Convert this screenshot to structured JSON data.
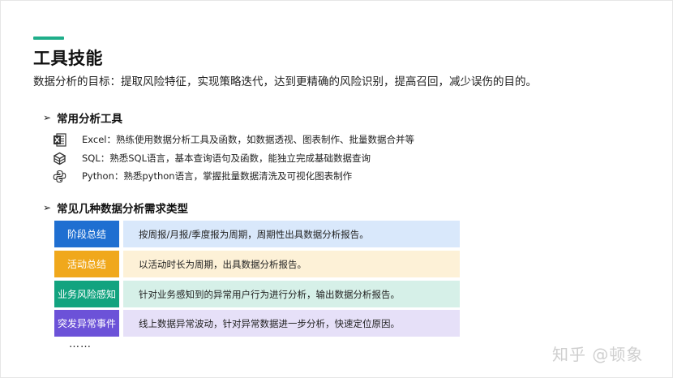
{
  "title": "工具技能",
  "subtitle": "数据分析的目标：提取风险特征，实现策略迭代，达到更精确的风险识别，提高召回，减少误伤的目的。",
  "tools_section": {
    "heading": "常用分析工具",
    "bullet": "➢",
    "items": [
      {
        "icon": "excel-icon",
        "text": "Excel：熟练使用数据分析工具及函数，如数据透视、图表制作、批量数据合并等"
      },
      {
        "icon": "database-icon",
        "text": "SQL：熟悉SQL语言，基本查询语句及函数，能独立完成基础数据查询"
      },
      {
        "icon": "python-icon",
        "text": "Python：熟悉python语言，掌握批量数据清洗及可视化图表制作"
      }
    ]
  },
  "types_section": {
    "heading": "常见几种数据分析需求类型",
    "bullet": "➢",
    "rows": [
      {
        "label": "阶段总结",
        "desc": "按周报/月报/季度报为周期，周期性出具数据分析报告。",
        "color": "#1f6fd1"
      },
      {
        "label": "活动总结",
        "desc": "以活动时长为周期，出具数据分析报告。",
        "color": "#f0a81c"
      },
      {
        "label": "业务风险感知",
        "desc": "针对业务感知到的异常用户行为进行分析，输出数据分析报告。",
        "color": "#12a37f"
      },
      {
        "label": "突发异常事件",
        "desc": "线上数据异常波动，针对异常数据进一步分析，快速定位原因。",
        "color": "#6c52d8"
      }
    ],
    "ellipsis": "……"
  },
  "watermark": {
    "text": "知乎 @顿象"
  },
  "colors": {
    "accent": "#1fae8a"
  }
}
